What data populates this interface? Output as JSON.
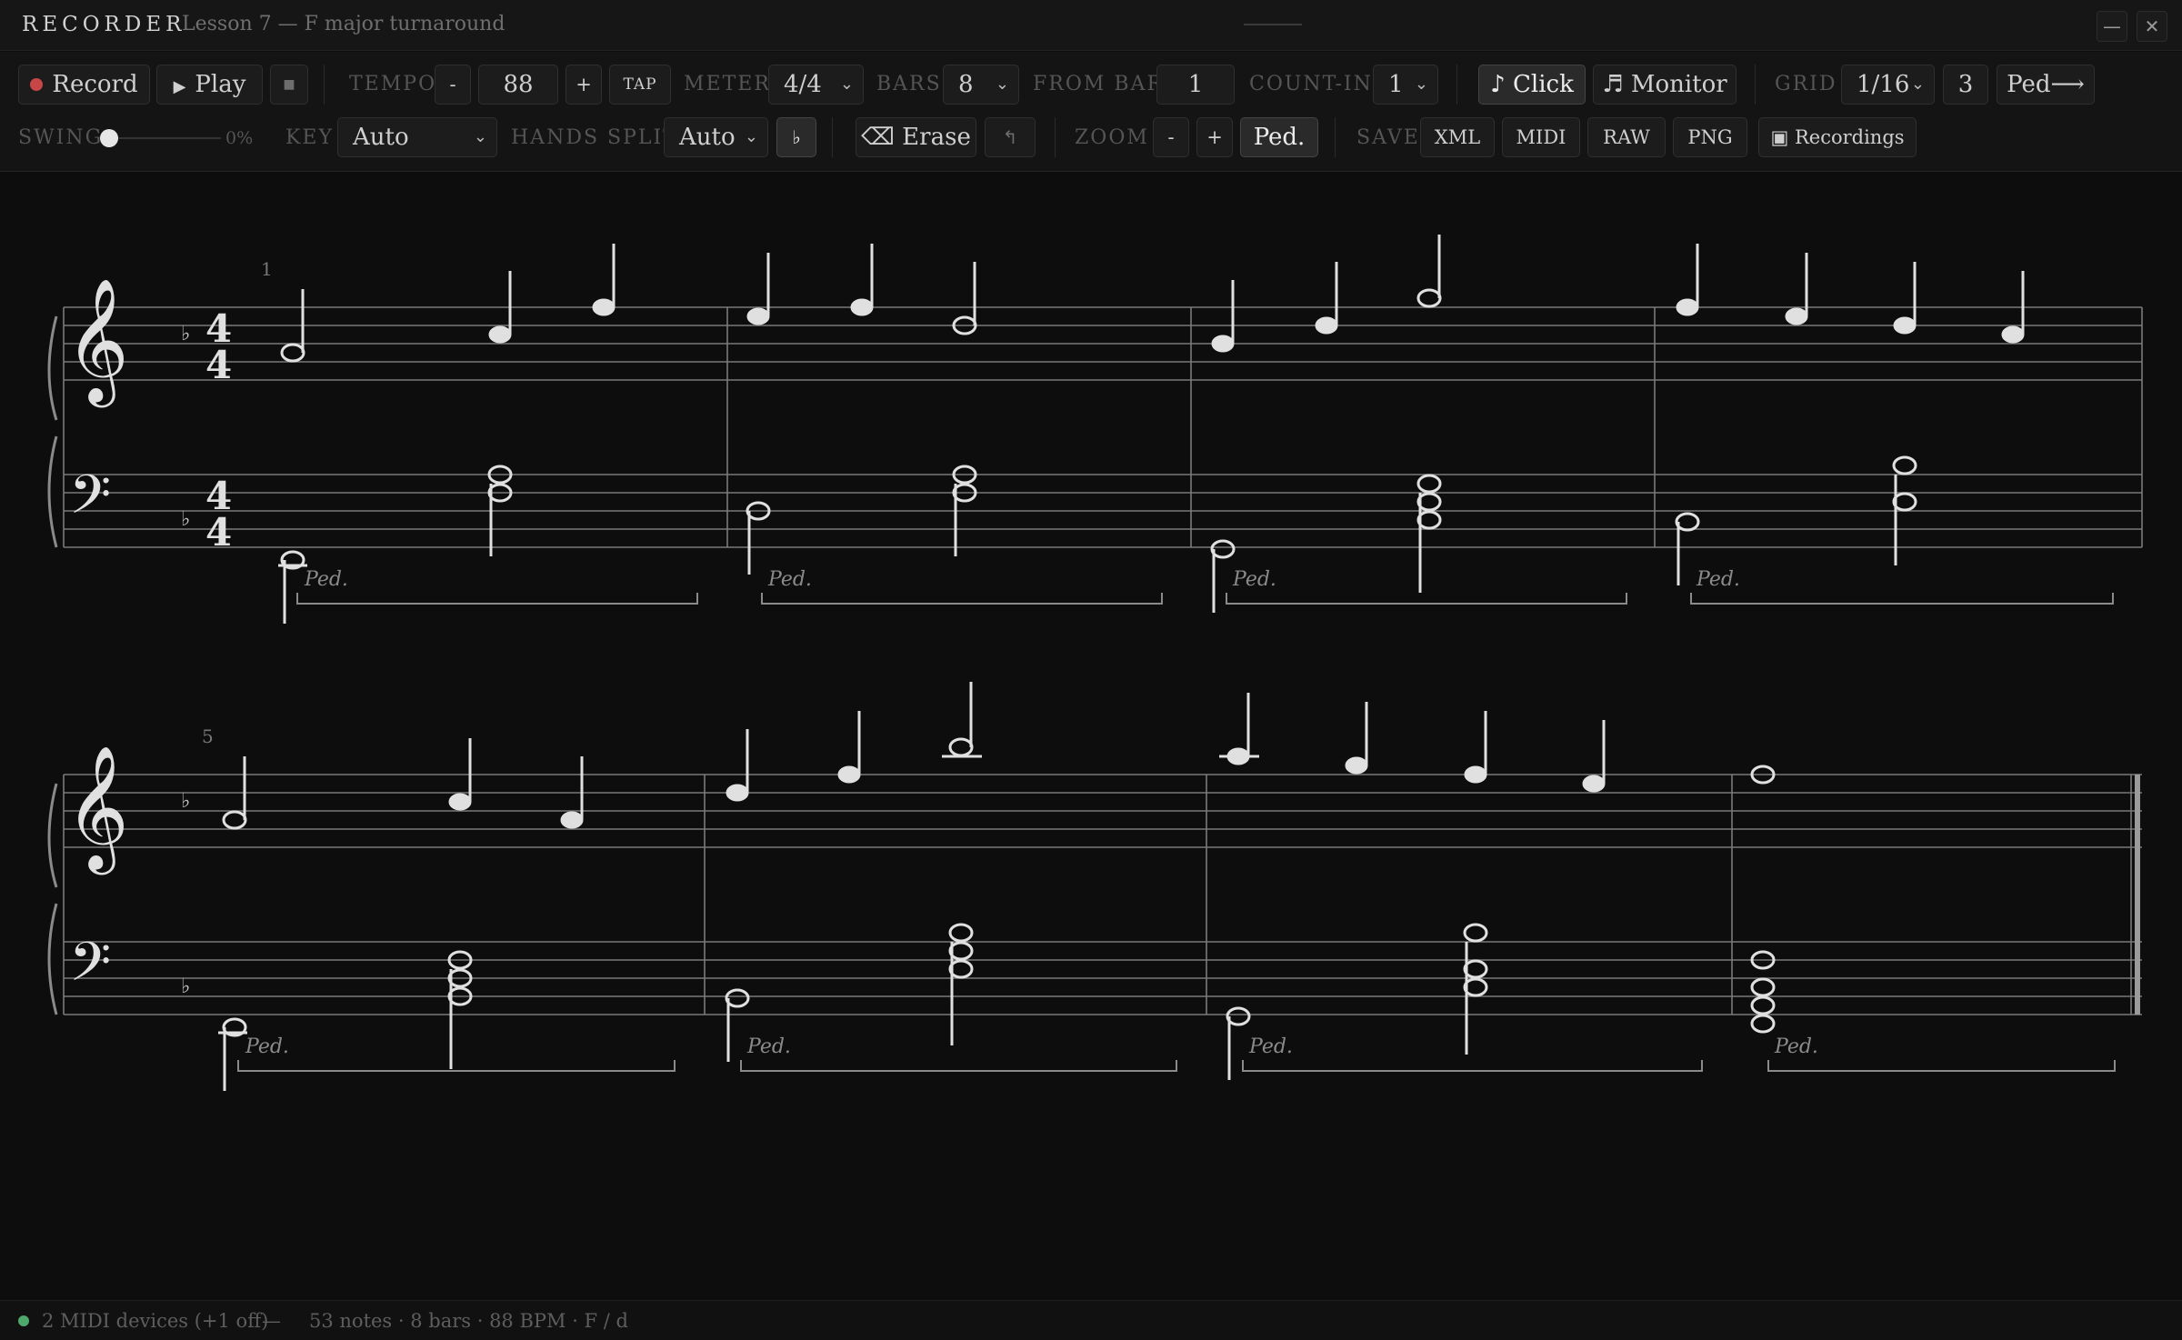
{
  "app": {
    "name": "RECORDER",
    "title": "Lesson 7 — F major turnaround"
  },
  "window": {
    "minimize": "—",
    "close": "✕"
  },
  "toolbar": {
    "record": "Record",
    "play": "Play",
    "stop": "■",
    "tempo_label": "TEMPO",
    "tempo_minus": "-",
    "tempo_value": "88",
    "tempo_plus": "+",
    "tap": "TAP",
    "meter_label": "METER",
    "meter_value": "4/4",
    "bars_label": "BARS",
    "bars_value": "8",
    "from_bar_label": "FROM BAR",
    "from_bar_value": "1",
    "count_in_label": "COUNT-IN",
    "count_in_value": "1",
    "click": "♪ Click",
    "monitor": "♬ Monitor",
    "grid_label": "GRID",
    "grid_value": "1/16",
    "triplet": "3",
    "ped_arrow": "Ped⟶",
    "swing_label": "SWING",
    "swing_value": "0%",
    "key_label": "KEY",
    "key_value": "Auto",
    "hands_split_label": "HANDS SPLIT",
    "hands_split_value": "Auto",
    "flat": "♭",
    "erase": "⌫ Erase",
    "undo": "↰",
    "zoom_label": "ZOOM",
    "zoom_minus": "-",
    "zoom_plus": "+",
    "ped": "Ped.",
    "save_label": "SAVE",
    "xml": "XML",
    "midi": "MIDI",
    "raw": "RAW",
    "png": "PNG",
    "recordings": "▣ Recordings"
  },
  "score": {
    "clef_treble": "𝄞",
    "clef_bass": "𝄢",
    "key_signature": "♭",
    "time_signature": [
      "4",
      "4"
    ],
    "pedal_mark": "Ped.",
    "systems": [
      {
        "start_bar": "1"
      },
      {
        "start_bar": "5"
      }
    ]
  },
  "status": {
    "midi": "2 MIDI devices (+1 off)",
    "separator": "—",
    "summary": "53 notes · 8 bars · 88 BPM · F / d"
  },
  "colors": {
    "background": "#0d0d0d",
    "ink": "#d8d8d8",
    "record": "#c84646",
    "status_ok": "#4fa86c"
  }
}
